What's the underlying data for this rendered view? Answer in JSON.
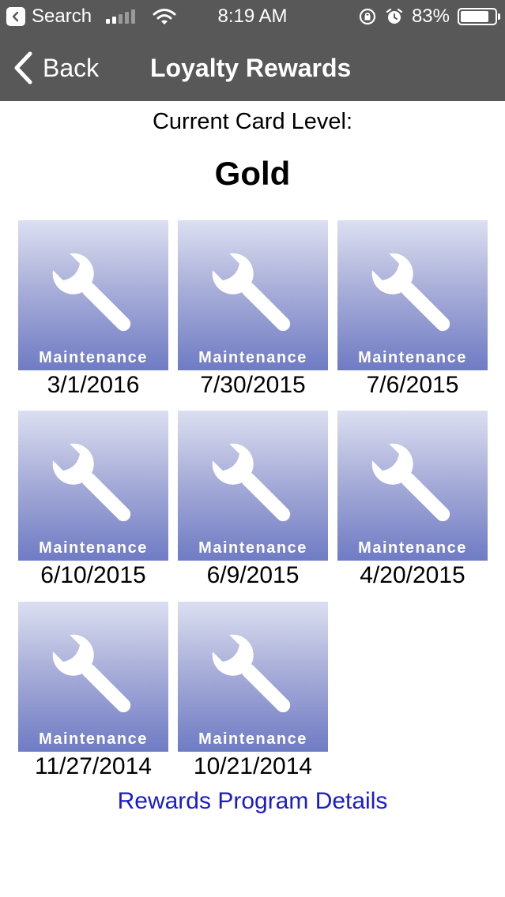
{
  "status_bar": {
    "back_app_label": "Search",
    "time": "8:19 AM",
    "battery_percent": "83%",
    "battery_level": 0.83,
    "icons": [
      "signal-icon",
      "wifi-icon",
      "rotation-lock-icon",
      "alarm-icon",
      "battery-icon"
    ]
  },
  "nav": {
    "back_label": "Back",
    "title": "Loyalty Rewards"
  },
  "card_level": {
    "label": "Current Card Level:",
    "value": "Gold"
  },
  "rewards": [
    {
      "caption": "Maintenance",
      "date": "3/1/2016",
      "icon": "wrench-icon"
    },
    {
      "caption": "Maintenance",
      "date": "7/30/2015",
      "icon": "wrench-icon"
    },
    {
      "caption": "Maintenance",
      "date": "7/6/2015",
      "icon": "wrench-icon"
    },
    {
      "caption": "Maintenance",
      "date": "6/10/2015",
      "icon": "wrench-icon"
    },
    {
      "caption": "Maintenance",
      "date": "6/9/2015",
      "icon": "wrench-icon"
    },
    {
      "caption": "Maintenance",
      "date": "4/20/2015",
      "icon": "wrench-icon"
    },
    {
      "caption": "Maintenance",
      "date": "11/27/2014",
      "icon": "wrench-icon"
    },
    {
      "caption": "Maintenance",
      "date": "10/21/2014",
      "icon": "wrench-icon"
    }
  ],
  "footer_link": "Rewards Program Details",
  "colors": {
    "bar_background": "#585858",
    "link": "#1a1ad1",
    "tile_gradient_top": "#dcdff1",
    "tile_gradient_bottom": "#6f7bc4"
  }
}
